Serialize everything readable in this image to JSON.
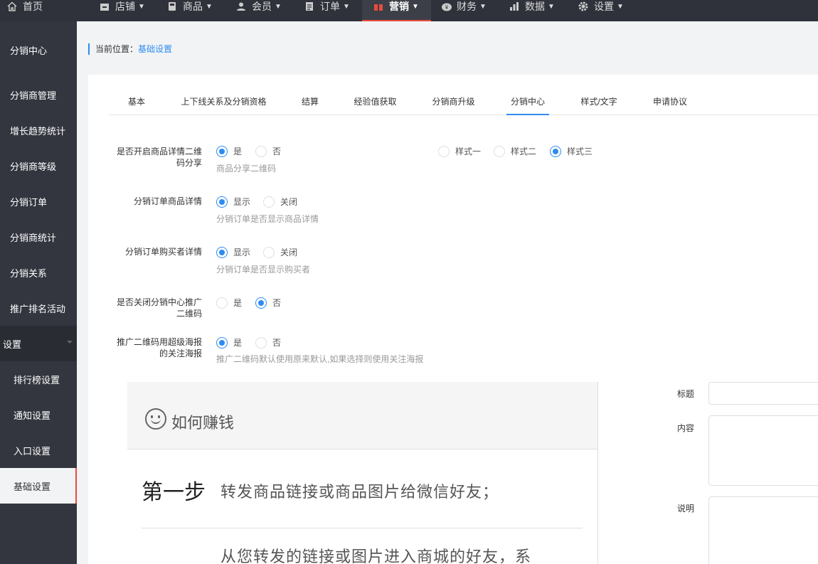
{
  "topnav": {
    "items": [
      {
        "label": "首页",
        "icon": "home-icon"
      },
      {
        "label": "店铺",
        "icon": "shop-icon"
      },
      {
        "label": "商品",
        "icon": "goods-icon"
      },
      {
        "label": "会员",
        "icon": "member-icon"
      },
      {
        "label": "订单",
        "icon": "order-icon"
      },
      {
        "label": "营销",
        "icon": "gift-icon"
      },
      {
        "label": "财务",
        "icon": "finance-icon"
      },
      {
        "label": "数据",
        "icon": "chart-icon"
      },
      {
        "label": "设置",
        "icon": "gear-icon"
      }
    ],
    "active": "营销",
    "accent_color": "#e84c3d"
  },
  "sidebar": {
    "items": [
      {
        "label": "分销中心"
      },
      {
        "label": "分销商管理"
      },
      {
        "label": "增长趋势统计"
      },
      {
        "label": "分销商等级"
      },
      {
        "label": "分销订单"
      },
      {
        "label": "分销商统计"
      },
      {
        "label": "分销关系"
      },
      {
        "label": "推广排名活动"
      }
    ],
    "group": {
      "label": "设置"
    },
    "sub_items": [
      {
        "label": "排行榜设置"
      },
      {
        "label": "通知设置"
      },
      {
        "label": "入口设置"
      },
      {
        "label": "基础设置"
      }
    ],
    "active": "基础设置"
  },
  "breadcrumb": {
    "prefix": "当前位置：",
    "current": "基础设置"
  },
  "tabs": {
    "items": [
      {
        "label": "基本"
      },
      {
        "label": "上下线关系及分销资格"
      },
      {
        "label": "结算"
      },
      {
        "label": "经验值获取"
      },
      {
        "label": "分销商升级"
      },
      {
        "label": "分销中心"
      },
      {
        "label": "样式/文字"
      },
      {
        "label": "申请协议"
      }
    ],
    "active": "分销中心",
    "accent_color": "#2d8cf0"
  },
  "settings": [
    {
      "label_line1": "是否开启商品详情二维",
      "label_line2": "码分享",
      "options": [
        "是",
        "否"
      ],
      "selected": "是",
      "hint": "商品分享二维码",
      "styles": {
        "options": [
          "样式一",
          "样式二",
          "样式三"
        ],
        "selected": "样式三"
      }
    },
    {
      "label_line1": "分销订单商品详情",
      "options": [
        "显示",
        "关闭"
      ],
      "selected": "显示",
      "hint": "分销订单是否显示商品详情"
    },
    {
      "label_line1": "分销订单购买者详情",
      "options": [
        "显示",
        "关闭"
      ],
      "selected": "显示",
      "hint": "分销订单是否显示购买者"
    },
    {
      "label_line1": "是否关闭分销中心推广",
      "label_line2": "二维码",
      "options": [
        "是",
        "否"
      ],
      "selected": "否"
    },
    {
      "label_line1": "推广二维码用超级海报",
      "label_line2": "的关注海报",
      "options": [
        "是",
        "否"
      ],
      "selected": "是",
      "hint": "推广二维码默认使用原来默认,如果选择则使用关注海报"
    }
  ],
  "preview": {
    "title": "如何赚钱",
    "step_label": "第一步",
    "step1_text": "转发商品链接或商品图片给微信好友；",
    "step2_text": "从您转发的链接或图片进入商城的好友，系"
  },
  "form": {
    "title_label": "标题",
    "content_label": "内容",
    "desc_label": "说明"
  }
}
